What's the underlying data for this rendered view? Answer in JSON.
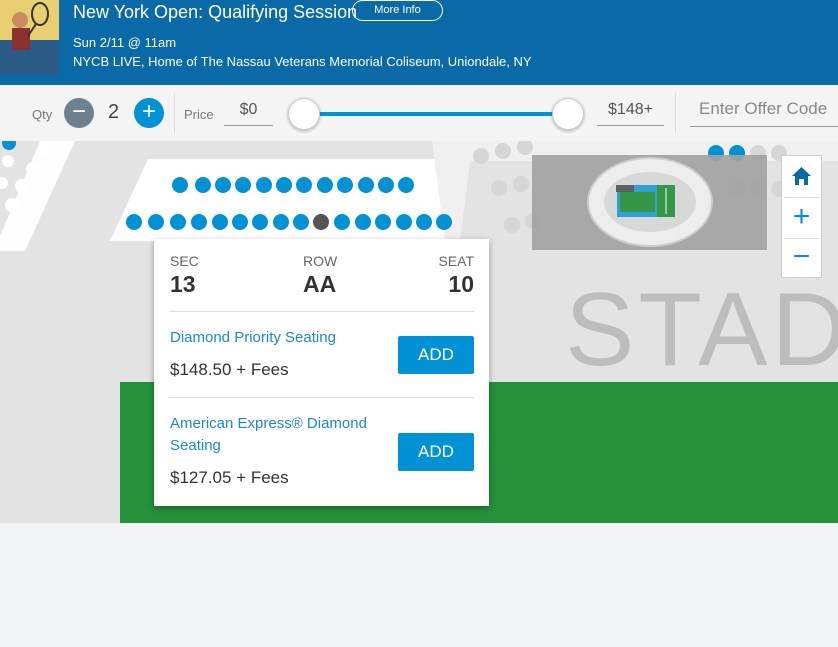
{
  "event": {
    "title": "New York Open: Qualifying Session",
    "more_info_label": "More Info",
    "date": "Sun 2/11 @ 11am",
    "venue": "NYCB LIVE, Home of The Nassau Veterans Memorial Coliseum, Uniondale, NY"
  },
  "toolbar": {
    "qty_label": "Qty",
    "qty_value": "2",
    "minus_glyph": "−",
    "plus_glyph": "+",
    "price_label": "Price",
    "price_min": "$0",
    "price_max": "$148+",
    "offer_placeholder": "Enter Offer Code",
    "price_range_fraction": [
      0,
      1
    ]
  },
  "map": {
    "watermark": "STAD",
    "zoom_in_glyph": "+",
    "zoom_out_glyph": "−",
    "home_icon": "home-icon",
    "selected_seat": "AA-10"
  },
  "seat_popup": {
    "section_label": "SEC",
    "section": "13",
    "row_label": "ROW",
    "row": "AA",
    "seat_label": "SEAT",
    "seat": "10",
    "offers": [
      {
        "name": "Diamond Priority Seating",
        "price": "$148.50 + Fees",
        "button": "ADD"
      },
      {
        "name": "American Express® Diamond Seating",
        "price": "$127.05 + Fees",
        "button": "ADD"
      }
    ]
  },
  "colors": {
    "header_bg": "#0a6aa8",
    "accent": "#0092d5",
    "seat_available": "#0092d5",
    "seat_selected": "#555555",
    "seat_unavailable": "#cfcfcf",
    "field": "#25913a"
  }
}
